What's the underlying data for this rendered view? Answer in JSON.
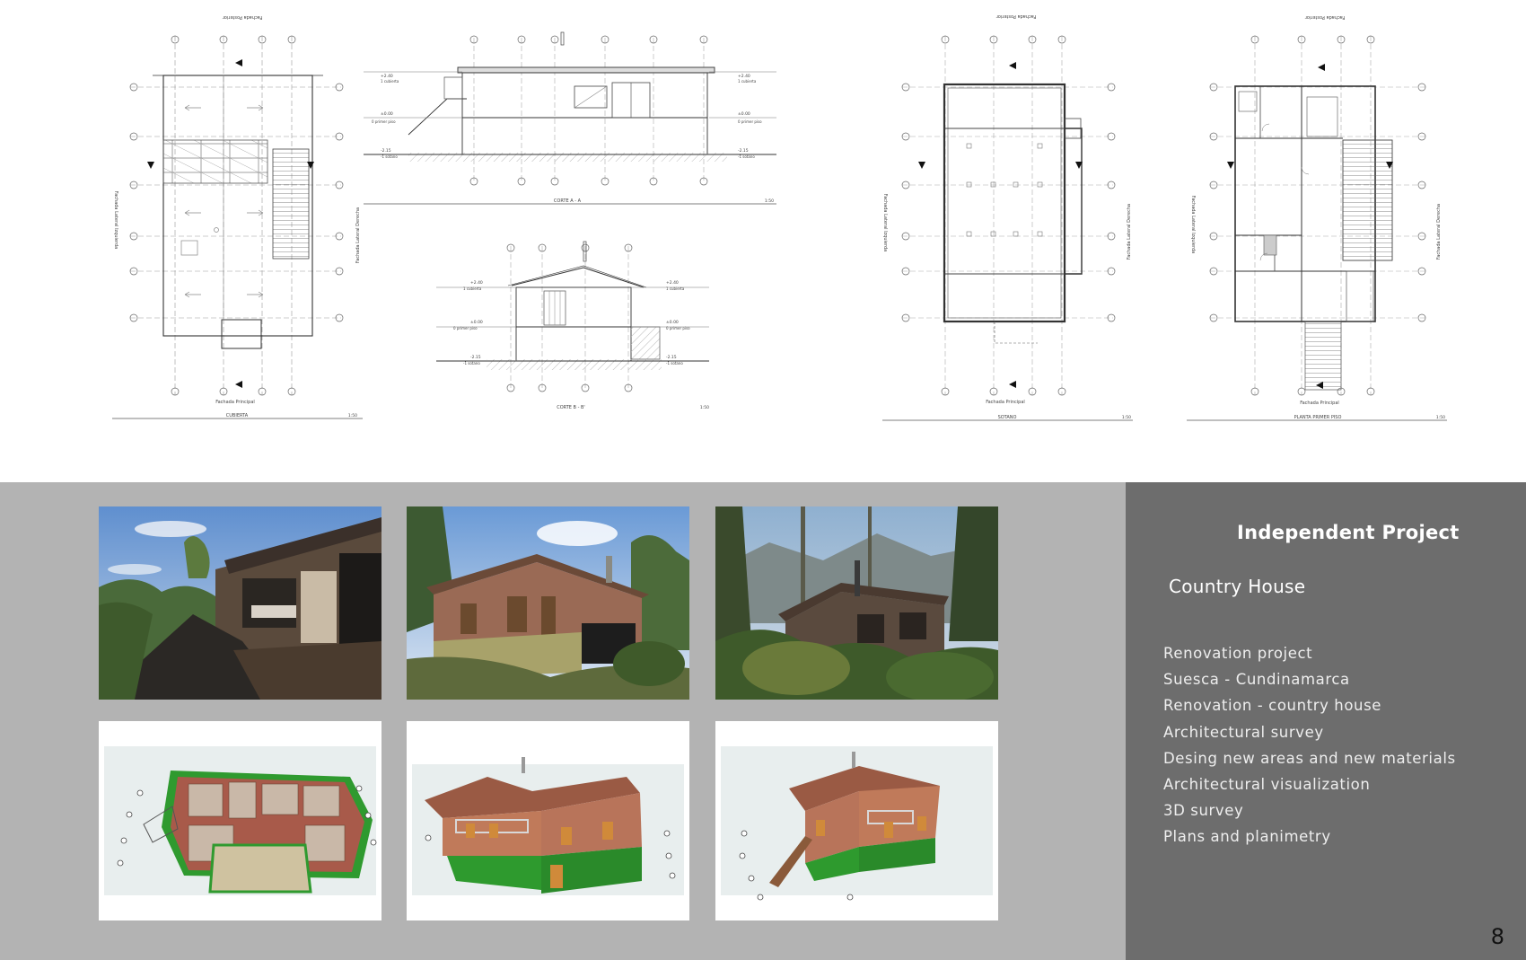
{
  "sheet": {
    "roof_plan": {
      "title": "CUBIERTA",
      "scale": "1:50",
      "facade_top": "Fachada Posterior",
      "facade_bottom": "Fachada Principal",
      "facade_left": "Fachada Lateral Izquierda",
      "facade_right": "Fachada Lateral Derecha"
    },
    "section_a": {
      "title": "CORTE A - A",
      "scale": "1:50",
      "levels": [
        "+2.40",
        "±0.00",
        "-2.15"
      ],
      "level_notes": [
        "1 cubierta",
        "0 primer piso",
        "-1 sotano"
      ]
    },
    "section_b": {
      "title": "CORTE B - B'",
      "scale": "1:50",
      "levels": [
        "+2.40",
        "±0.00",
        "-2.15"
      ],
      "level_notes": [
        "1 cubierta",
        "0 primer piso",
        "-1 sotano"
      ]
    },
    "basement_plan": {
      "title": "SOTANO",
      "scale": "1:50",
      "facade_top": "Fachada Posterior",
      "facade_bottom": "Fachada Principal",
      "facade_left": "Fachada Lateral Izquierda",
      "facade_right": "Fachada Lateral Derecha"
    },
    "first_floor_plan": {
      "title": "PLANTA PRIMER PISO",
      "scale": "1:50",
      "facade_top": "Fachada Posterior",
      "facade_bottom": "Fachada Principal",
      "facade_left": "Fachada Lateral Izquierda",
      "facade_right": "Fachada Lateral Derecha"
    }
  },
  "info": {
    "title": "Independent Project",
    "subtitle": "Country House",
    "items": [
      "Renovation project",
      "Suesca - Cundinamarca",
      "Renovation - country house",
      "Architectural survey",
      "Desing new areas and new materials",
      "Architectural visualization",
      "3D survey",
      "Plans and planimetry"
    ],
    "page_number": "8"
  },
  "colors": {
    "gallery_bg": "#b3b3b3",
    "panel_bg": "#6d6d6d",
    "panel_text": "#ffffff",
    "render_green": "#2f9a2f",
    "render_roof": "#9a5a44"
  }
}
